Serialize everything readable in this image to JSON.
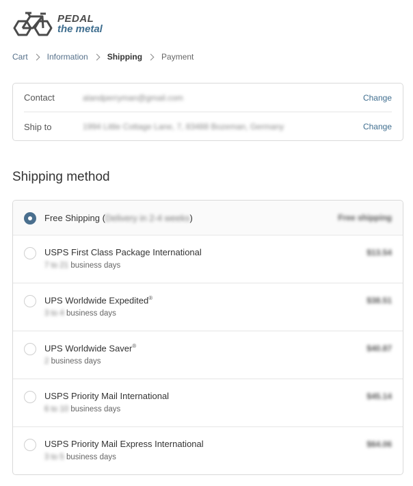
{
  "brand": {
    "line1": "PEDAL",
    "line2": "the metal",
    "colors": {
      "dark": "#4a4a4a",
      "accent": "#3f6e8f"
    }
  },
  "breadcrumb": [
    "Cart",
    "Information",
    "Shipping",
    "Payment"
  ],
  "review": {
    "contact_label": "Contact",
    "contact_value": "alandperryman@gmail.com",
    "shipto_label": "Ship to",
    "shipto_value": "1994 Little Cottage Lane, 7, 83488 Bozeman, Germany",
    "change_label": "Change"
  },
  "shipping": {
    "title": "Shipping method",
    "methods": [
      {
        "name": "Free Shipping",
        "detail": "Delivery in 2-4 weeks",
        "price": "Free shipping",
        "selected": true
      },
      {
        "name": "USPS First Class Package International",
        "days_range": "7 to 21",
        "days_label": "business days",
        "price": "$13.54",
        "selected": false
      },
      {
        "name": "UPS Worldwide Expedited",
        "sup": "®",
        "days_range": "3 to 4",
        "days_label": "business days",
        "price": "$38.51",
        "selected": false
      },
      {
        "name": "UPS Worldwide Saver",
        "sup": "®",
        "days_range": "2",
        "days_label": "business days",
        "price": "$40.87",
        "selected": false
      },
      {
        "name": "USPS Priority Mail International",
        "days_range": "6 to 10",
        "days_label": "business days",
        "price": "$45.14",
        "selected": false
      },
      {
        "name": "USPS Priority Mail Express International",
        "days_range": "3 to 5",
        "days_label": "business days",
        "price": "$64.06",
        "selected": false
      }
    ]
  }
}
